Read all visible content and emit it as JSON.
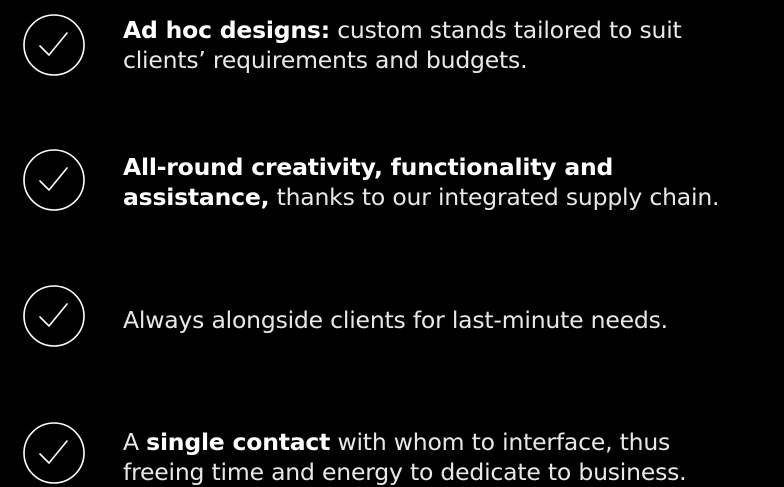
{
  "features": [
    {
      "icon": "check-circle-icon",
      "bold": "Ad hoc designs:",
      "line1_rest": " custom stands tailored to suit",
      "line2": "clients’ requirements and budgets."
    },
    {
      "icon": "check-circle-icon",
      "bold_line1": "All-round creativity, functionality and",
      "bold_line2": "assistance,",
      "line2_rest": " thanks to our integrated supply chain."
    },
    {
      "icon": "check-circle-icon",
      "text": "Always alongside clients for last-minute needs."
    },
    {
      "icon": "check-circle-icon",
      "prefix": "A ",
      "bold": "single contact",
      "line1_rest": " with whom to interface, thus",
      "line2": "freeing time and energy to dedicate to business."
    }
  ],
  "colors": {
    "background": "#000000",
    "text": "#ffffff",
    "icon_stroke": "#ffffff"
  }
}
